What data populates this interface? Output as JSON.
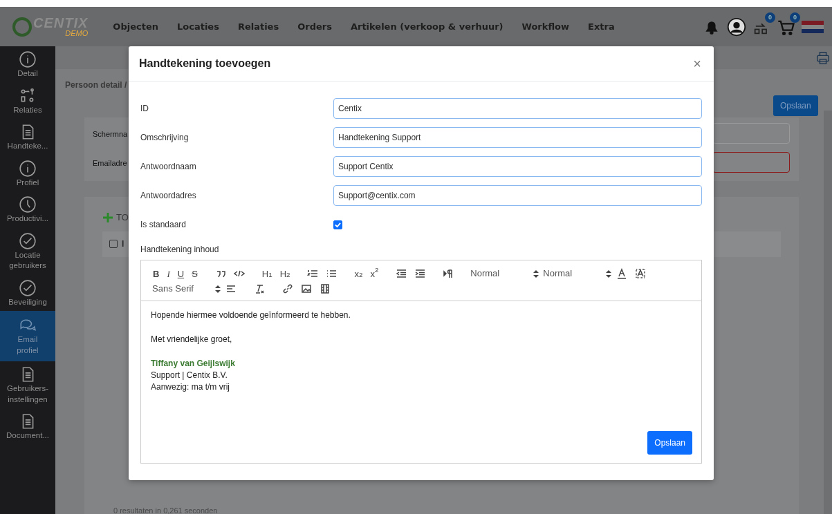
{
  "brand": {
    "name": "CENTIX",
    "tag": "DEMO"
  },
  "nav": [
    "Objecten",
    "Locaties",
    "Relaties",
    "Orders",
    "Artikelen (verkoop & verhuur)",
    "Workflow",
    "Extra"
  ],
  "header_icons": [
    {
      "kind": "bell"
    },
    {
      "kind": "user"
    },
    {
      "kind": "tasks",
      "badge": "0"
    },
    {
      "kind": "cart",
      "badge": "0"
    },
    {
      "kind": "flag"
    }
  ],
  "sidebar": {
    "items": [
      {
        "label": "Detail",
        "kind": "info",
        "selected": false
      },
      {
        "label": "Relaties",
        "kind": "relations",
        "selected": false
      },
      {
        "label": "Handteke...",
        "kind": "document",
        "selected": false
      },
      {
        "label": "Profiel",
        "kind": "info",
        "selected": false
      },
      {
        "label": "Productivi...",
        "kind": "clock",
        "selected": false
      },
      {
        "label": "Locatie gebruikers",
        "kind": "check",
        "selected": false
      },
      {
        "label": "Beveiliging",
        "kind": "check",
        "selected": false
      },
      {
        "label": "Email profiel",
        "kind": "chat",
        "selected": true
      },
      {
        "label": "Gebruikers-instellingen",
        "kind": "document",
        "selected": false
      },
      {
        "label": "Document...",
        "kind": "document",
        "selected": false
      }
    ]
  },
  "page": {
    "breadcrumb": "Persoon detail /",
    "save_button": "Opslaan",
    "fields": [
      {
        "label": "Schermna",
        "invalid": false
      },
      {
        "label": "Emailadre",
        "invalid": true
      }
    ],
    "add_label": "TO",
    "table_header": "I",
    "table_checkbox": {
      "checked": false
    },
    "status": "0 resultaten in 0,261 seconden"
  },
  "modal": {
    "title": "Handtekening toevoegen",
    "close": "×",
    "fields": [
      {
        "label": "ID",
        "value": "Centix"
      },
      {
        "label": "Omschrijving",
        "value": "Handtekening Support"
      },
      {
        "label": "Antwoordnaam",
        "value": "Support Centix"
      },
      {
        "label": "Antwoordadres",
        "value": "Support@centix.com"
      }
    ],
    "checkbox": {
      "label": "Is standaard",
      "checked": true
    },
    "editor": {
      "label": "Handtekening inhoud",
      "toolbar": [
        [
          [
            {
              "kind": "bold",
              "label": "B"
            },
            {
              "kind": "italic",
              "label": "I"
            },
            {
              "kind": "underline",
              "label": "U"
            },
            {
              "kind": "strike",
              "label": "S"
            }
          ],
          [
            {
              "kind": "quote"
            },
            {
              "kind": "code"
            }
          ],
          [
            {
              "kind": "header",
              "label": "H$_{1}$"
            },
            {
              "kind": "header",
              "label": "H$_{2}$"
            }
          ],
          [
            {
              "kind": "ordered"
            },
            {
              "kind": "bullet"
            }
          ],
          [
            {
              "kind": "script",
              "label": "x$_{2}$"
            },
            {
              "kind": "script",
              "label": "x$^{2}$"
            }
          ],
          [
            {
              "kind": "outdent"
            },
            {
              "kind": "indent"
            }
          ],
          [
            {
              "kind": "direction"
            }
          ],
          [
            {
              "kind": "select",
              "label": "Normal"
            },
            {
              "kind": "select",
              "label": "Normal"
            },
            {
              "kind": "color"
            },
            {
              "kind": "background"
            }
          ]
        ],
        [
          [
            {
              "kind": "select",
              "label": "Sans Serif"
            },
            {
              "kind": "align"
            }
          ],
          [
            {
              "kind": "clean"
            }
          ],
          [
            {
              "kind": "link"
            },
            {
              "kind": "image"
            },
            {
              "kind": "video"
            }
          ]
        ]
      ],
      "content": [
        [
          {
            "kind": "plain",
            "text": "Hopende hiermee voldoende geïnformeerd te hebben."
          }
        ],
        [
          {
            "kind": "plain",
            "text": "Met vriendelijke groet,"
          }
        ],
        [
          {
            "kind": "name",
            "text": "Tiffany van Geijlswijk"
          },
          {
            "kind": "plain",
            "text": "Support | Centix B.V."
          },
          {
            "kind": "plain",
            "text": "Aanwezig: ma t/m vrij"
          }
        ]
      ]
    },
    "save_button": "Opslaan"
  }
}
